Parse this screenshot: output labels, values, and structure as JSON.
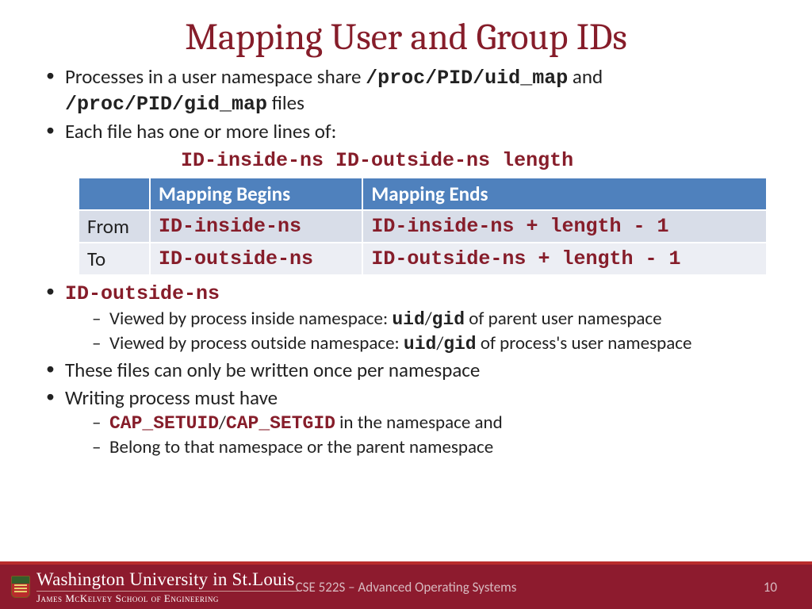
{
  "title": "Mapping User and Group IDs",
  "bullets": {
    "b1_pre": "Processes in a user namespace share ",
    "b1_code1": "/proc/PID/uid_map",
    "b1_mid": " and ",
    "b1_code2": "/proc/PID/gid_map",
    "b1_post": " files",
    "b2": "Each file has one or more lines of:",
    "format": "ID-inside-ns ID-outside-ns length",
    "b3_code": "ID-outside-ns",
    "b3s1_pre": "Viewed by process inside namespace: ",
    "b3s1_code1": "uid",
    "b3s1_slash": "/",
    "b3s1_code2": "gid",
    "b3s1_post": " of parent user namespace",
    "b3s2_pre": "Viewed by process outside namespace: ",
    "b3s2_code1": "uid",
    "b3s2_slash": "/",
    "b3s2_code2": "gid",
    "b3s2_post": " of process's user namespace",
    "b4": "These files can only be written once per namespace",
    "b5": "Writing process must have",
    "b5s1_code1": "CAP_SETUID",
    "b5s1_slash": "/",
    "b5s1_code2": "CAP_SETGID",
    "b5s1_post": " in the namespace and",
    "b5s2": "Belong to that namespace or the parent namespace"
  },
  "table": {
    "headers": {
      "corner": "",
      "c1": "Mapping Begins",
      "c2": "Mapping Ends"
    },
    "rows": [
      {
        "label": "From",
        "c1": "ID-inside-ns",
        "c2": "ID-inside-ns + length - 1"
      },
      {
        "label": "To",
        "c1": "ID-outside-ns",
        "c2": "ID-outside-ns + length - 1"
      }
    ]
  },
  "footer": {
    "univ1": "Washington University in St.Louis",
    "univ2": "James McKelvey School of Engineering",
    "course": "CSE 522S – Advanced Operating Systems",
    "page": "10"
  }
}
